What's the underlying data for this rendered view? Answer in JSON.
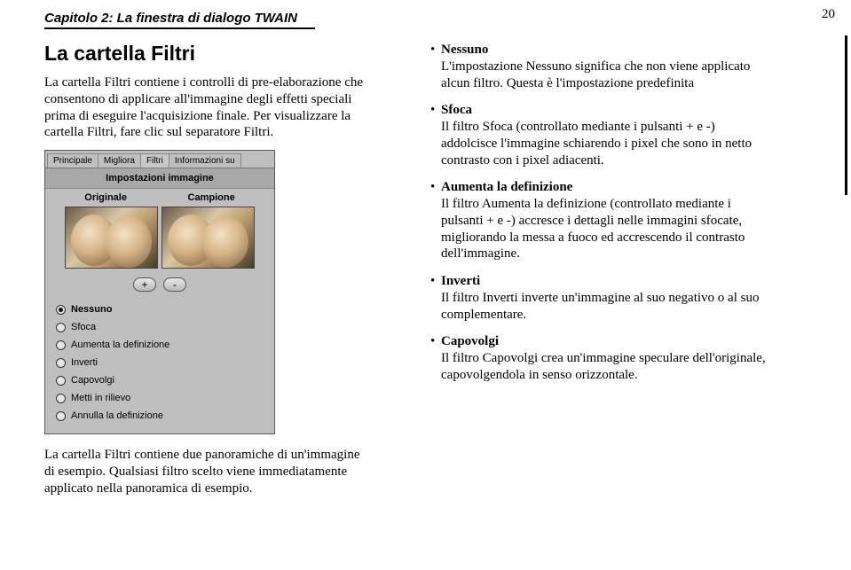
{
  "pageNumber": "20",
  "chapterHeader": "Capitolo 2: La finestra di dialogo TWAIN",
  "left": {
    "title": "La cartella Filtri",
    "intro": "La cartella Filtri contiene i controlli di pre-elaborazione che consentono di applicare all'immagine degli effetti speciali prima di eseguire l'acquisizione finale. Per visualizzare la cartella Filtri, fare clic sul separatore Filtri.",
    "belowPanel": "La cartella Filtri contiene due panoramiche di un'immagine di esempio. Qualsiasi filtro scelto viene immediatamente applicato nella panoramica di esempio."
  },
  "panel": {
    "tabs": [
      "Principale",
      "Migliora",
      "Filtri",
      "Informazioni su"
    ],
    "activeTab": 2,
    "banner": "Impostazioni immagine",
    "compareLeft": "Originale",
    "compareRight": "Campione",
    "plus": "+",
    "minus": "-",
    "options": [
      {
        "label": "Nessuno",
        "checked": true,
        "bold": true
      },
      {
        "label": "Sfoca",
        "checked": false,
        "bold": false
      },
      {
        "label": "Aumenta la definizione",
        "checked": false,
        "bold": false
      },
      {
        "label": "Inverti",
        "checked": false,
        "bold": false
      },
      {
        "label": "Capovolgi",
        "checked": false,
        "bold": false
      },
      {
        "label": "Metti in rilievo",
        "checked": false,
        "bold": false
      },
      {
        "label": "Annulla la definizione",
        "checked": false,
        "bold": false
      }
    ]
  },
  "right": {
    "items": [
      {
        "title": "Nessuno",
        "text": "L'impostazione Nessuno significa che non viene applicato alcun filtro. Questa è l'impostazione predefinita"
      },
      {
        "title": "Sfoca",
        "text": "Il filtro Sfoca (controllato mediante i pulsanti + e -) addolcisce l'immagine schiarendo i pixel che sono in netto contrasto con i pixel adiacenti."
      },
      {
        "title": "Aumenta la definizione",
        "text": "Il filtro Aumenta la definizione (controllato mediante i pulsanti + e -) accresce i dettagli nelle immagini sfocate, migliorando la messa a fuoco ed accrescendo il contrasto dell'immagine."
      },
      {
        "title": "Inverti",
        "text": "Il filtro Inverti inverte un'immagine al suo negativo o al suo complementare."
      },
      {
        "title": "Capovolgi",
        "text": "Il filtro Capovolgi crea un'immagine speculare dell'originale, capovolgendola in senso orizzontale."
      }
    ]
  }
}
